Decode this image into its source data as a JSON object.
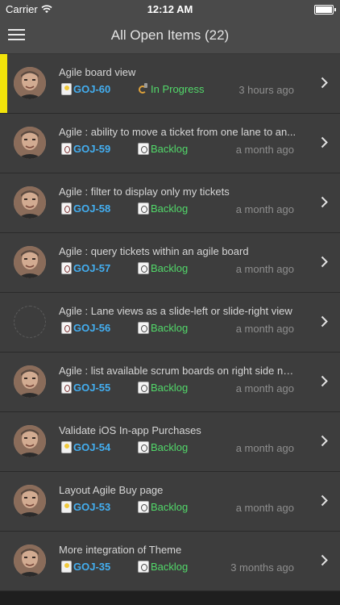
{
  "status_bar": {
    "carrier": "Carrier",
    "time": "12:12 AM"
  },
  "nav": {
    "title": "All Open Items (22)"
  },
  "items": [
    {
      "summary": "Agile board view",
      "key": "GOJ-60",
      "type": "story",
      "status": "In Progress",
      "status_type": "progress",
      "time": "3 hours ago",
      "selected": true,
      "avatar": true
    },
    {
      "summary": "Agile : ability to move a ticket from one lane to an...",
      "key": "GOJ-59",
      "type": "task",
      "status": "Backlog",
      "status_type": "backlog",
      "time": "a month ago",
      "selected": false,
      "avatar": true
    },
    {
      "summary": "Agile : filter to display only my tickets",
      "key": "GOJ-58",
      "type": "task",
      "status": "Backlog",
      "status_type": "backlog",
      "time": "a month ago",
      "selected": false,
      "avatar": true
    },
    {
      "summary": "Agile : query tickets within an agile board",
      "key": "GOJ-57",
      "type": "task",
      "status": "Backlog",
      "status_type": "backlog",
      "time": "a month ago",
      "selected": false,
      "avatar": true
    },
    {
      "summary": "Agile : Lane views as a slide-left or slide-right view",
      "key": "GOJ-56",
      "type": "task",
      "status": "Backlog",
      "status_type": "backlog",
      "time": "a month ago",
      "selected": false,
      "avatar": false
    },
    {
      "summary": "Agile : list available scrum boards on right side na...",
      "key": "GOJ-55",
      "type": "task",
      "status": "Backlog",
      "status_type": "backlog",
      "time": "a month ago",
      "selected": false,
      "avatar": true
    },
    {
      "summary": "Validate iOS In-app Purchases",
      "key": "GOJ-54",
      "type": "story",
      "status": "Backlog",
      "status_type": "backlog",
      "time": "a month ago",
      "selected": false,
      "avatar": true
    },
    {
      "summary": "Layout Agile Buy page",
      "key": "GOJ-53",
      "type": "story",
      "status": "Backlog",
      "status_type": "backlog",
      "time": "a month ago",
      "selected": false,
      "avatar": true
    },
    {
      "summary": "More integration of Theme",
      "key": "GOJ-35",
      "type": "story",
      "status": "Backlog",
      "status_type": "backlog",
      "time": "3 months ago",
      "selected": false,
      "avatar": true
    }
  ],
  "colors": {
    "selected_accent": "#f2e30a",
    "key": "#43aef0",
    "status": "#52d86a",
    "row_bg": "#3d3d3d",
    "bar_bg": "#4a4a4a"
  },
  "icons": {
    "menu": "hamburger-icon",
    "disclosure": "chevron-right-icon",
    "story": "lightbulb-icon",
    "task": "task-icon",
    "in_progress": "in-progress-icon",
    "backlog": "backlog-icon"
  }
}
